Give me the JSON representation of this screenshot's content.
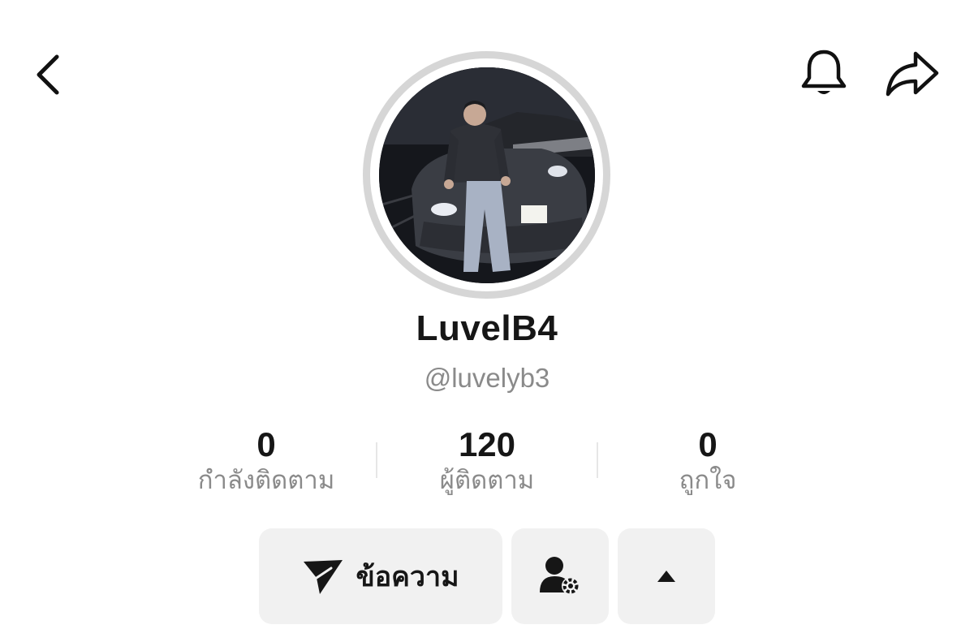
{
  "header": {
    "back_icon": "chevron-left-icon",
    "notification_icon": "bell-icon",
    "share_icon": "share-arrow-icon"
  },
  "profile": {
    "avatar_alt": "profile photo",
    "display_name": "LuvelB4",
    "handle": "@luvelyb3"
  },
  "stats": [
    {
      "value": "0",
      "label": "กำลังติดตาม"
    },
    {
      "value": "120",
      "label": "ผู้ติดตาม"
    },
    {
      "value": "0",
      "label": "ถูกใจ"
    }
  ],
  "actions": {
    "message_label": "ข้อความ",
    "message_icon": "send-arrow-icon",
    "follow_settings_icon": "user-gear-icon",
    "more_icon": "caret-up-icon"
  },
  "colors": {
    "background": "#ffffff",
    "text_primary": "#161616",
    "text_secondary": "#8a8a8a",
    "button_bg": "#f1f1f1",
    "avatar_ring": "#d6d6d6"
  }
}
